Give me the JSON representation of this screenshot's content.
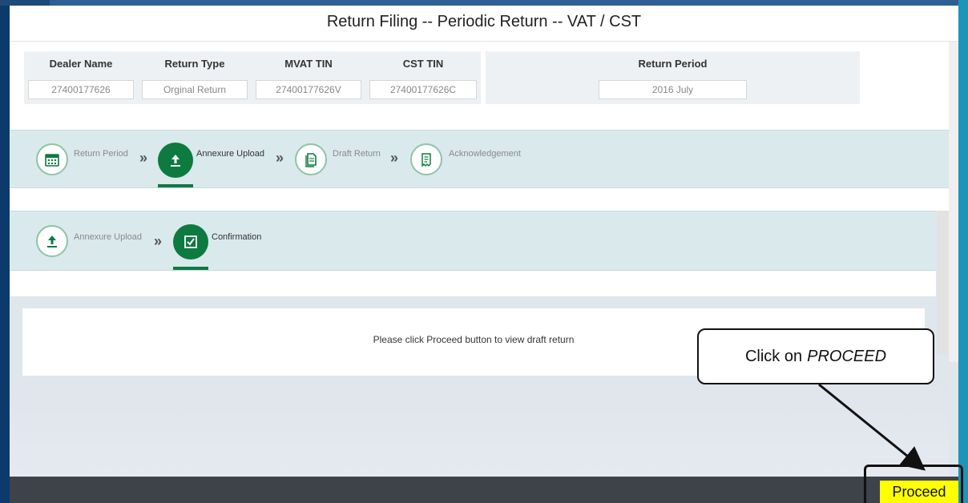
{
  "page": {
    "title": "Return Filing -- Periodic Return -- VAT / CST"
  },
  "info": {
    "headers": {
      "dealer_name": "Dealer Name",
      "return_type": "Return Type",
      "mvat_tin": "MVAT TIN",
      "cst_tin": "CST TIN",
      "return_period": "Return Period"
    },
    "values": {
      "dealer_name": "27400177626",
      "return_type": "Orginal Return",
      "mvat_tin": "27400177626V",
      "cst_tin": "27400177626C",
      "return_period": "2016 July"
    }
  },
  "main_steps": [
    {
      "label": "Return Period",
      "icon": "calendar-icon",
      "active": false
    },
    {
      "label": "Annexure Upload",
      "icon": "upload-icon",
      "active": true
    },
    {
      "label": "Draft Return",
      "icon": "document-icon",
      "active": false
    },
    {
      "label": "Acknowledgement",
      "icon": "receipt-icon",
      "active": false
    }
  ],
  "sub_steps": [
    {
      "label": "Annexure Upload",
      "icon": "upload-icon",
      "active": false
    },
    {
      "label": "Confirmation",
      "icon": "checkbox-icon",
      "active": true
    }
  ],
  "separator": "»",
  "message": "Please click Proceed button to view draft return",
  "callout": {
    "prefix": "Click on",
    "emphasis": "PROCEED"
  },
  "footer": {
    "proceed_label": "Proceed"
  },
  "colors": {
    "active_step": "#0d7a3f",
    "stepper_bg": "#d9e9ec",
    "highlight": "#ffff00",
    "footer_bg": "#3d4349"
  }
}
